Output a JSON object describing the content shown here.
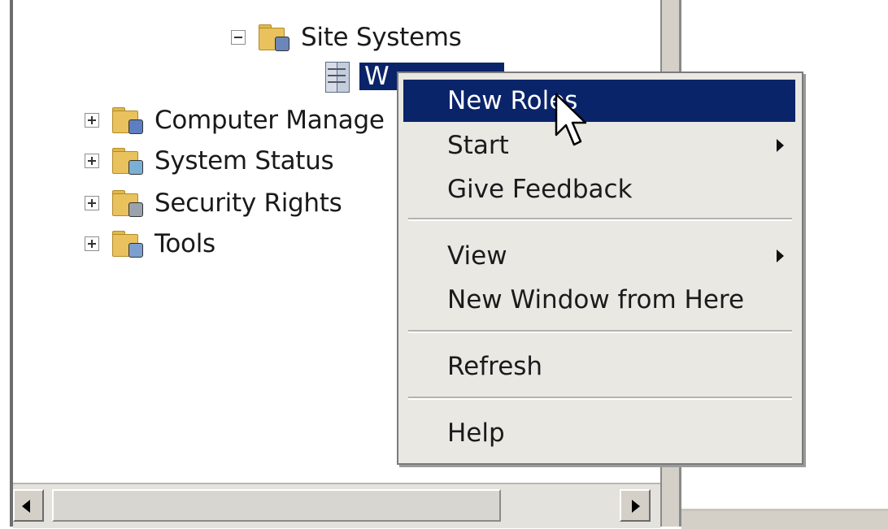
{
  "tree": {
    "site_systems": {
      "label": "Site Systems",
      "expanded": true
    },
    "selected_server": {
      "label": "W"
    },
    "items": [
      {
        "label": "Computer Manage",
        "expander": "+"
      },
      {
        "label": "System Status",
        "expander": "+"
      },
      {
        "label": "Security Rights",
        "expander": "+"
      },
      {
        "label": "Tools",
        "expander": "+"
      }
    ]
  },
  "context_menu": {
    "items": [
      {
        "label": "New Roles",
        "highlighted": true
      },
      {
        "label": "Start",
        "submenu": true
      },
      {
        "label": "Give Feedback"
      },
      {
        "label": "View",
        "submenu": true
      },
      {
        "label": "New Window from Here"
      },
      {
        "label": "Refresh"
      },
      {
        "label": "Help"
      }
    ]
  },
  "colors": {
    "selection": "#0a246a",
    "menu_background": "#e9e8e3",
    "folder": "#e9c25d"
  },
  "icons": {
    "tree_folder": "folder-icon",
    "server": "server-icon",
    "cursor": "mouse-pointer-icon"
  }
}
